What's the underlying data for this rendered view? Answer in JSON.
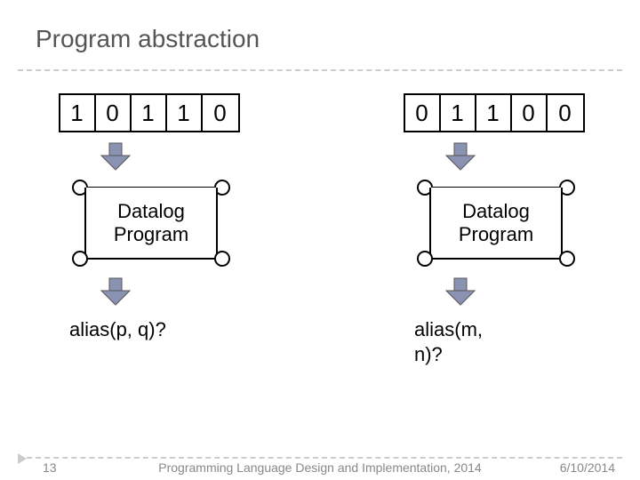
{
  "title": "Program abstraction",
  "left": {
    "bits": [
      "1",
      "0",
      "1",
      "1",
      "0"
    ],
    "box_label": "Datalog\nProgram",
    "alias": "alias(p, q)?"
  },
  "right": {
    "bits": [
      "0",
      "1",
      "1",
      "0",
      "0"
    ],
    "box_label": "Datalog\nProgram",
    "alias": "alias(m, n)?"
  },
  "footer": {
    "page": "13",
    "center": "Programming Language Design and Implementation, 2014",
    "date": "6/10/2014"
  },
  "colors": {
    "arrow": "#8a92b2"
  }
}
